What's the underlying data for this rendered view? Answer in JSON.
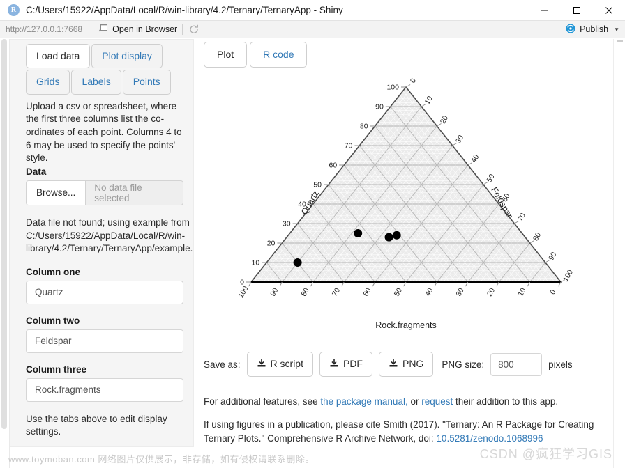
{
  "window": {
    "title": "C:/Users/15922/AppData/Local/R/win-library/4.2/Ternary/TernaryApp - Shiny",
    "app_icon_letter": "R",
    "minimize": "—",
    "maximize": "□",
    "close": "✕"
  },
  "toolbar": {
    "url": "http://127.0.0.1:7668",
    "open_in_browser": "Open in Browser",
    "reload_icon": "refresh-icon",
    "publish": "Publish",
    "publish_caret": "▼"
  },
  "sidebar": {
    "tabs": [
      {
        "label": "Load data",
        "active": true
      },
      {
        "label": "Plot display",
        "active": false
      },
      {
        "label": "Grids",
        "active": false
      },
      {
        "label": "Labels",
        "active": false
      },
      {
        "label": "Points",
        "active": false
      }
    ],
    "help_text": "Upload a csv or spreadsheet, where the first three columns list the co-ordinates of each point. Columns 4 to 6 may be used to specify the points' style.",
    "data_label": "Data",
    "browse_button": "Browse...",
    "file_placeholder": "No data file selected",
    "not_found_line1": "Data file not found; using example from",
    "not_found_line2": "C:/Users/15922/AppData/Local/R/win-",
    "not_found_line3": "library/4.2/Ternary/TernaryApp/example.csv",
    "column_one_label": "Column one",
    "column_one_value": "Quartz",
    "column_two_label": "Column two",
    "column_two_value": "Feldspar",
    "column_three_label": "Column three",
    "column_three_value": "Rock.fragments",
    "tail_note": "Use the tabs above to edit display settings."
  },
  "main": {
    "tabs": [
      {
        "label": "Plot",
        "active": true
      },
      {
        "label": "R code",
        "active": false
      }
    ],
    "save_as_label": "Save as:",
    "download_buttons": [
      {
        "label": "R script",
        "icon": "download-icon"
      },
      {
        "label": "PDF",
        "icon": "download-icon"
      },
      {
        "label": "PNG",
        "icon": "download-icon"
      }
    ],
    "png_size_label": "PNG size:",
    "png_size_value": "800",
    "pixels_label": "pixels",
    "footer1_pre": "For additional features, see ",
    "footer1_link1": "the package manual,",
    "footer1_mid": " or ",
    "footer1_link2": "request",
    "footer1_post": " their addition to this app.",
    "footer2_pre": "If using figures in a publication, please cite Smith (2017). \"Ternary: An R Package for Creating Ternary Plots.\" Comprehensive R Archive Network, doi: ",
    "footer2_link": "10.5281/zenodo.1068996"
  },
  "watermarks": {
    "bottom": "www.toymoban.com 网络图片仅供展示，非存储，如有侵权请联系删除。",
    "csdn": "CSDN @疯狂学习GIS"
  },
  "chart_data": {
    "type": "scatter",
    "subtype": "ternary",
    "title": "",
    "axes": [
      {
        "name": "Quartz",
        "position": "left",
        "ticks": [
          0,
          10,
          20,
          30,
          40,
          50,
          60,
          70,
          80,
          90,
          100
        ]
      },
      {
        "name": "Feldspar",
        "position": "right",
        "ticks": [
          0,
          10,
          20,
          30,
          40,
          50,
          60,
          70,
          80,
          90,
          100
        ]
      },
      {
        "name": "Rock.fragments",
        "position": "bottom",
        "ticks": [
          100,
          90,
          80,
          70,
          60,
          50,
          40,
          30,
          20,
          10,
          0
        ]
      }
    ],
    "grid": true,
    "grid_minor": true,
    "point_color": "#000000",
    "point_shape": "circle",
    "points": [
      {
        "quartz": 10,
        "feldspar": 10,
        "rock_fragments": 80
      },
      {
        "quartz": 25,
        "feldspar": 22,
        "rock_fragments": 53
      },
      {
        "quartz": 23,
        "feldspar": 33,
        "rock_fragments": 44
      },
      {
        "quartz": 24,
        "feldspar": 35,
        "rock_fragments": 41
      }
    ],
    "xlabel": "Rock.fragments",
    "ylabel": ""
  }
}
